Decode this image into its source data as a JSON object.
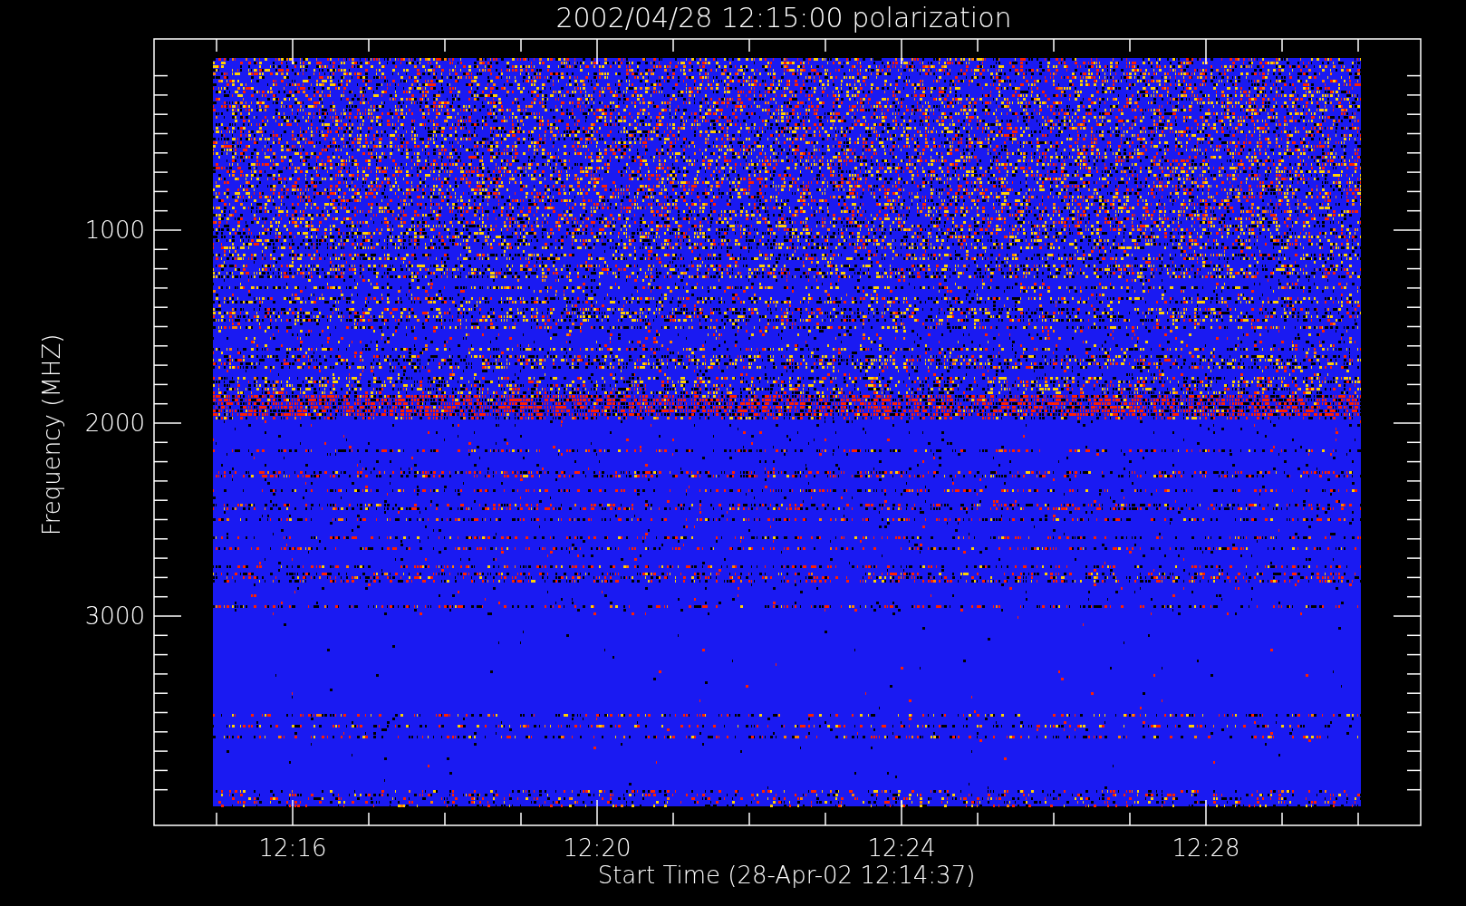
{
  "plot": {
    "title": "2002/04/28 12:15:00 polarization",
    "y_axis": {
      "label": "Frequency (MHZ)",
      "ticks": [
        "1000",
        "2000",
        "3000"
      ]
    },
    "x_axis": {
      "label": "Start Time (28-Apr-02 12:14:37)",
      "ticks": [
        "12:16",
        "12:20",
        "12:24",
        "12:28"
      ]
    }
  }
}
